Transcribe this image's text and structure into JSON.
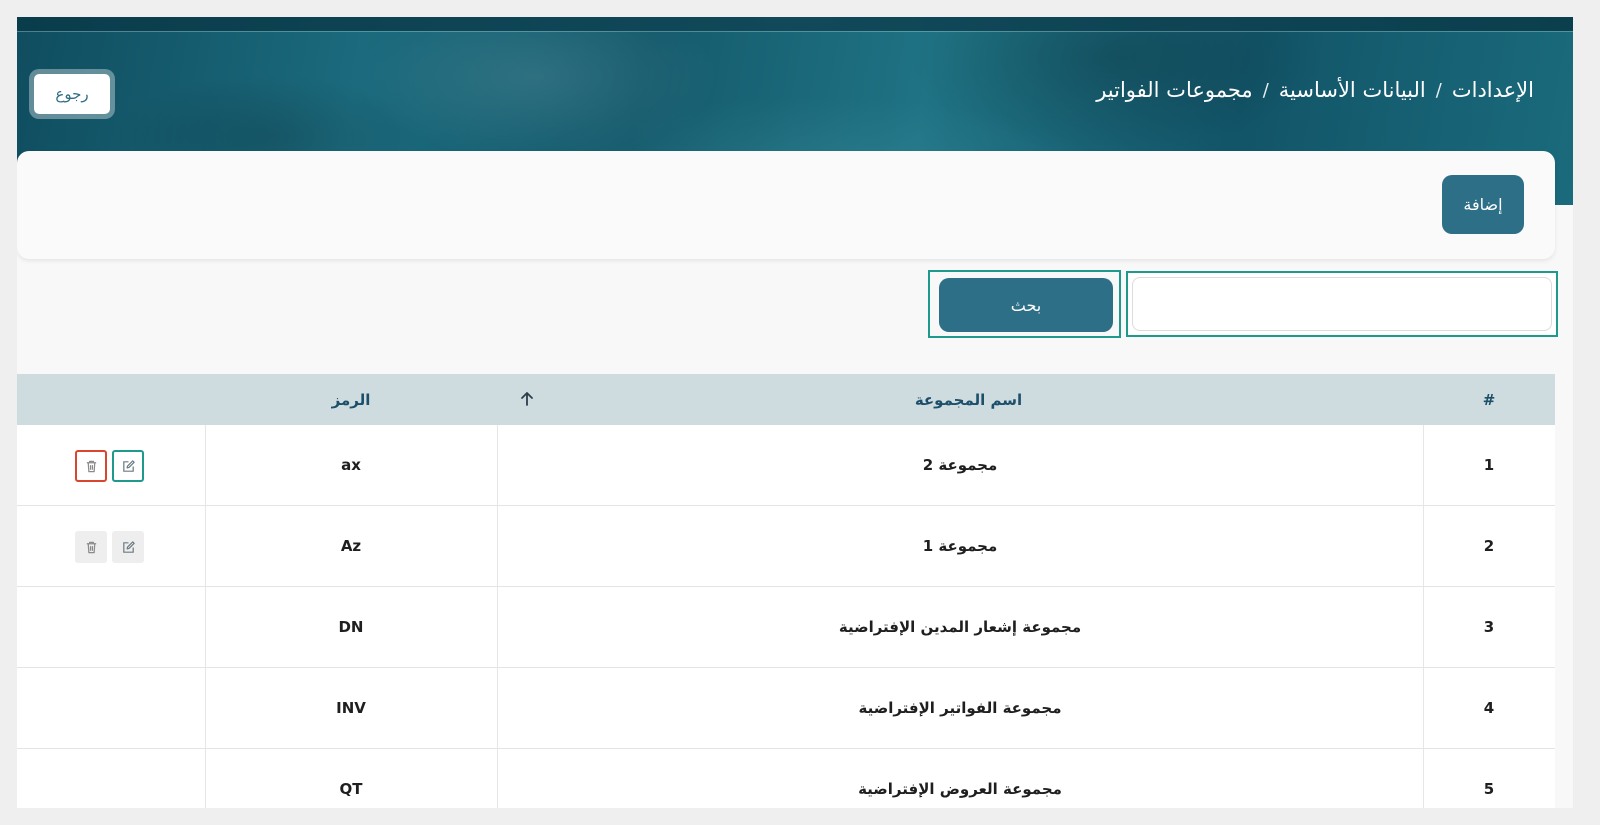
{
  "header": {
    "back_label": "رجوع",
    "breadcrumb": [
      "الإعدادات",
      "البيانات الأساسية",
      "مجموعات الفواتير"
    ],
    "separator": "/"
  },
  "toolbar": {
    "add_label": "إضافة"
  },
  "search": {
    "value": "",
    "placeholder": "",
    "button_label": "بحث"
  },
  "table": {
    "columns": {
      "index": "#",
      "name": "اسم المجموعة",
      "code": "الرمز"
    },
    "sort_icon": "arrow-up-icon",
    "rows": [
      {
        "index": "1",
        "name": "مجموعة 2",
        "code": "ax",
        "actions": true
      },
      {
        "index": "2",
        "name": "مجموعة 1",
        "code": "Az",
        "actions": true
      },
      {
        "index": "3",
        "name": "مجموعة إشعار المدين الإفتراضية",
        "code": "DN",
        "actions": false
      },
      {
        "index": "4",
        "name": "مجموعة الفواتير الإفتراضية",
        "code": "INV",
        "actions": false
      },
      {
        "index": "5",
        "name": "مجموعة العروض الإفتراضية",
        "code": "QT",
        "actions": false
      }
    ]
  },
  "colors": {
    "primary": "#2e6f88",
    "highlight": "#1e9a8c",
    "danger": "#d9452f",
    "header_row": "#cfdcdf"
  }
}
